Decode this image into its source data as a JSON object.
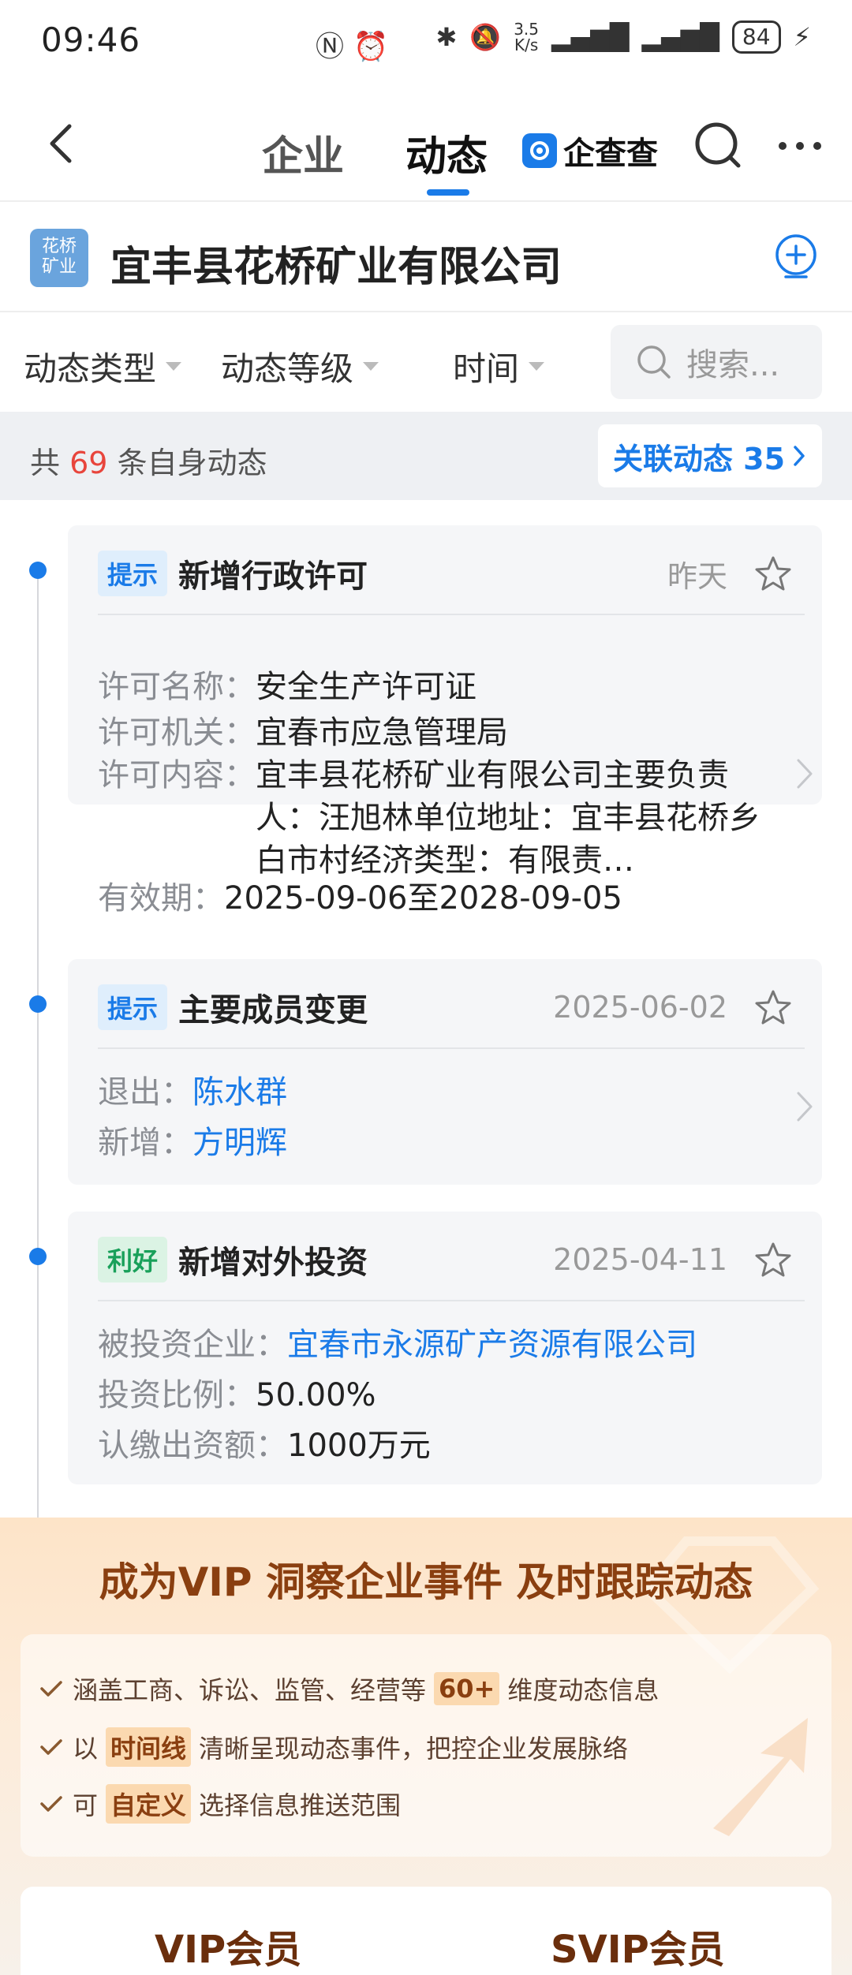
{
  "status_bar": {
    "time": "09:46",
    "speed": "3.5\nK/s",
    "battery": "84"
  },
  "nav": {
    "tabs": [
      "企业",
      "动态"
    ],
    "active_tab": "动态",
    "brand": "企查查"
  },
  "company": {
    "logo_text": "花桥\n矿业",
    "name": "宜丰县花桥矿业有限公司"
  },
  "filters": {
    "type": "动态类型",
    "level": "动态等级",
    "time": "时间",
    "search_placeholder": "搜索..."
  },
  "count": {
    "prefix": "共",
    "number": "69",
    "suffix": "条自身动态",
    "related_label": "关联动态 35"
  },
  "events": [
    {
      "tag": "提示",
      "title": "新增行政许可",
      "date": "昨天",
      "fields": [
        {
          "label": "许可名称：",
          "value": "安全生产许可证"
        },
        {
          "label": "许可机关：",
          "value": "宜春市应急管理局"
        },
        {
          "label": "许可内容：",
          "value": "宜丰县花桥矿业有限公司主要负责人：汪旭林单位地址：宜丰县花桥乡白市村经济类型：有限责…"
        },
        {
          "label": "有效期：",
          "value": "2025-09-06至2028-09-05"
        }
      ]
    },
    {
      "tag": "提示",
      "title": "主要成员变更",
      "date": "2025-06-02",
      "fields": [
        {
          "label": "退出：",
          "value": "陈水群"
        },
        {
          "label": "新增：",
          "value": "方明辉"
        }
      ]
    },
    {
      "tag": "利好",
      "title": "新增对外投资",
      "date": "2025-04-11",
      "fields": [
        {
          "label": "被投资企业：",
          "value": "宜春市永源矿产资源有限公司"
        },
        {
          "label": "投资比例：",
          "value": "50.00%"
        },
        {
          "label": "认缴出资额：",
          "value": "1000万元"
        }
      ]
    }
  ],
  "vip": {
    "title": "成为VIP 洞察企业事件 及时跟踪动态",
    "benefits": [
      {
        "pre": "涵盖工商、诉讼、监管、经营等",
        "hl": "60+",
        "post": "维度动态信息"
      },
      {
        "pre": "以",
        "hl": "时间线",
        "post": "清晰呈现动态事件，把控企业发展脉络"
      },
      {
        "pre": "可",
        "hl": "自定义",
        "post": "选择信息推送范围"
      }
    ],
    "tiers": [
      "VIP会员",
      "SVIP会员"
    ]
  },
  "colors": {
    "accent": "#1a7be8",
    "good": "#19a05a",
    "count_red": "#e8453c",
    "vip_brown": "#8a3f10"
  }
}
